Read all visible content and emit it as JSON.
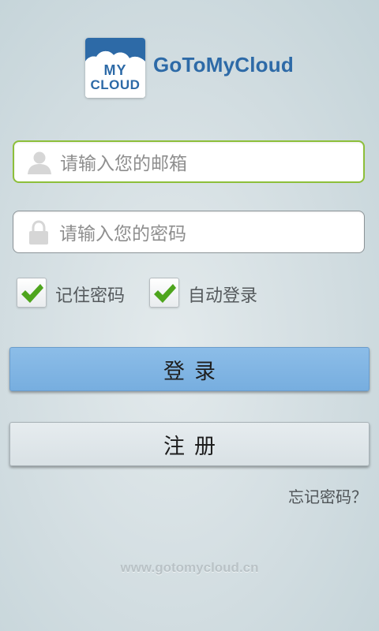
{
  "logo": {
    "line1": "MY",
    "line2": "CLOUD",
    "brand": "GoToMyCloud",
    "icon": "cloud-logo-icon"
  },
  "email_field": {
    "placeholder": "请输入您的邮箱",
    "value": "",
    "icon": "user-icon",
    "focused": true
  },
  "password_field": {
    "placeholder": "请输入您的密码",
    "value": "",
    "icon": "lock-icon"
  },
  "options": {
    "remember_password": {
      "label": "记住密码",
      "checked": true
    },
    "auto_login": {
      "label": "自动登录",
      "checked": true
    }
  },
  "buttons": {
    "login": "登录",
    "register": "注册"
  },
  "forgot_password": "忘记密码？",
  "footer_url": "www.gotomycloud.cn",
  "colors": {
    "brand_blue": "#2d6aa7",
    "focus_green": "#8dbf3a",
    "login_button": "#7fb4e3",
    "check_green": "#4ea51d"
  }
}
